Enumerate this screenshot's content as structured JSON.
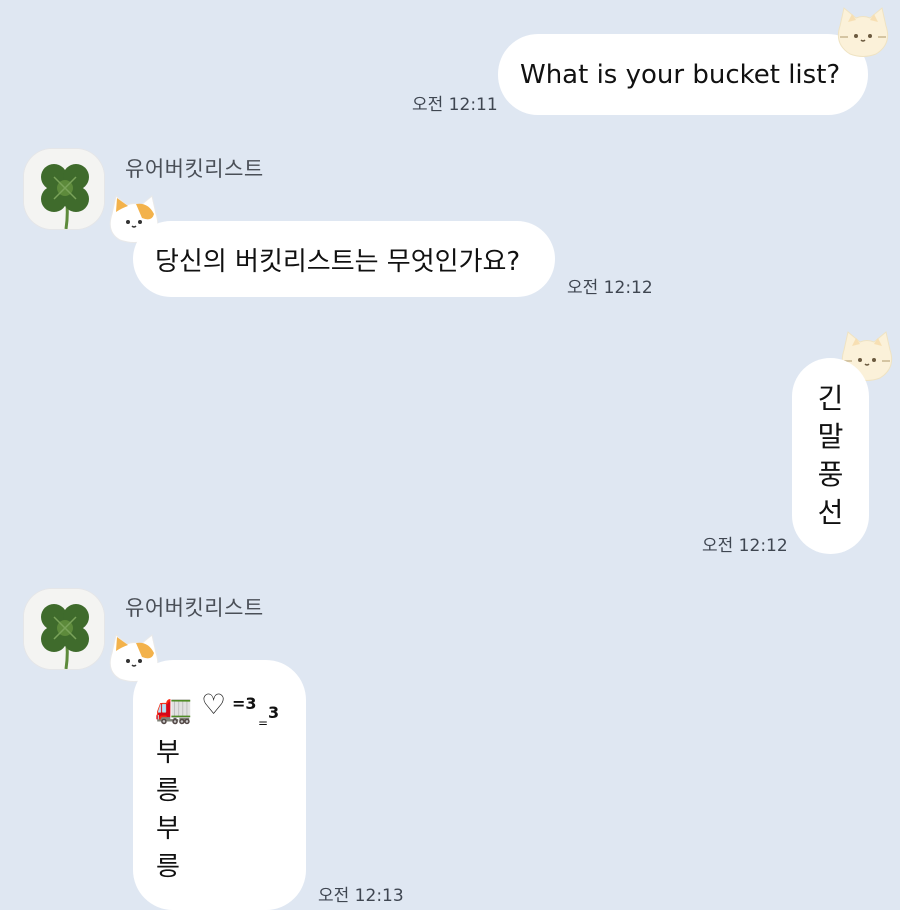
{
  "colors": {
    "background": "#dfe7f2",
    "bubble": "#ffffff",
    "timestamp": "#3f4651"
  },
  "messages": [
    {
      "side": "outgoing",
      "text": "What is your bucket list?",
      "time": "오전 12:11"
    },
    {
      "side": "incoming",
      "sender": "유어버킷리스트",
      "text": "당신의 버킷리스트는 무엇인가요?",
      "time": "오전 12:12"
    },
    {
      "side": "outgoing",
      "text_vertical": [
        "긴",
        "말",
        "풍",
        "선"
      ],
      "time": "오전 12:12"
    },
    {
      "side": "incoming",
      "sender": "유어버킷리스트",
      "emoji_line": {
        "truck": "🚛",
        "heart": "♡",
        "puff1": "=3",
        "puff2_eq": "=",
        "puff2_num": "3"
      },
      "text_vertical": [
        "부",
        "릉",
        "부",
        "릉"
      ],
      "time": "오전 12:13"
    }
  ],
  "icons": {
    "avatar": "four-leaf-clover-icon",
    "sticker": "cat-face-icon"
  }
}
